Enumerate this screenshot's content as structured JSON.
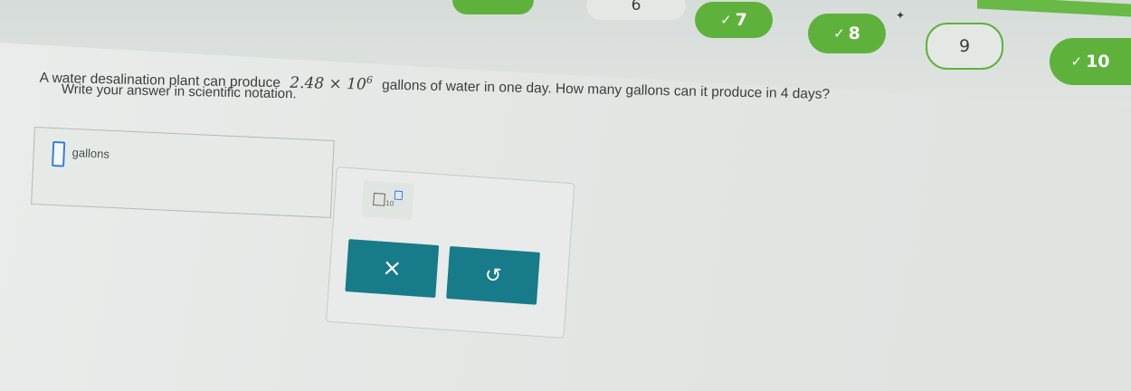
{
  "progress": {
    "steps": [
      {
        "label": "6",
        "status": "current"
      },
      {
        "label": "7",
        "status": "done"
      },
      {
        "label": "8",
        "status": "done"
      },
      {
        "label": "9",
        "status": "todo"
      },
      {
        "label": "10",
        "status": "done"
      }
    ],
    "check_glyph": "✓",
    "colors": {
      "done": "#5eb23c"
    }
  },
  "question": {
    "text_before": "A water desalination plant can produce",
    "coefficient_expr": "2.48 × 10",
    "exponent": "6",
    "text_after": "gallons of water in one day. How many gallons can it produce in 4 days?",
    "instruction": "Write your answer in scientific notation."
  },
  "answer": {
    "value": "",
    "unit": "gallons"
  },
  "keypad": {
    "sci_base": "10",
    "clear_label": "×",
    "undo_label": "↺",
    "colors": {
      "button": "#177b8a"
    }
  }
}
